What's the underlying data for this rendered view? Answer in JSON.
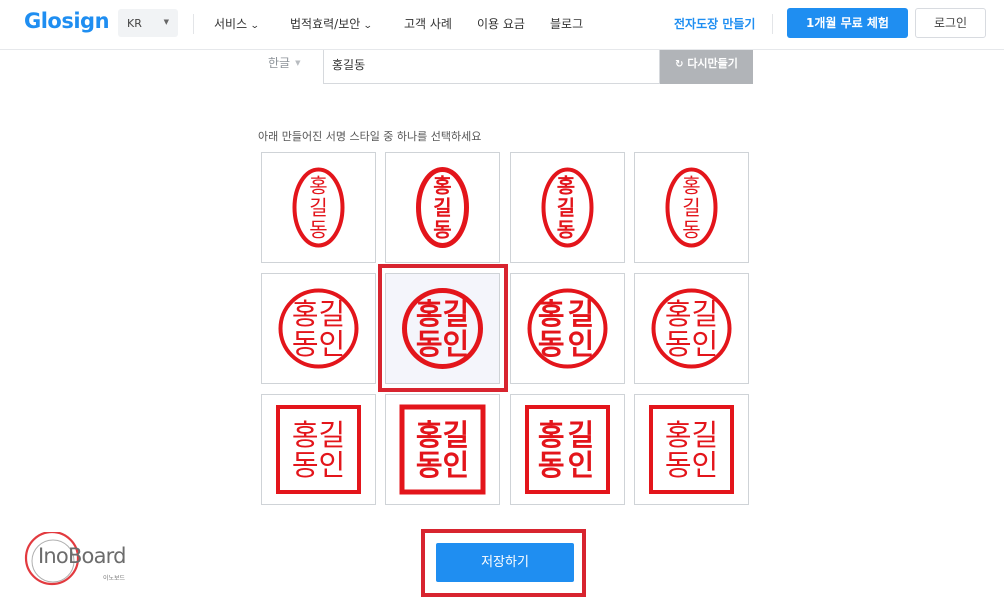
{
  "header": {
    "logo": "Glosign",
    "language": "KR",
    "nav": [
      {
        "label": "서비스",
        "dropdown": true
      },
      {
        "label": "법적효력/보안",
        "dropdown": true
      },
      {
        "label": "고객 사례",
        "dropdown": false
      },
      {
        "label": "이용 요금",
        "dropdown": false
      },
      {
        "label": "블로그",
        "dropdown": false
      }
    ],
    "make_stamp_link": "전자도장 만들기",
    "trial_button": "1개월 무료 체험",
    "login_button": "로그인"
  },
  "form": {
    "script_select": "한글",
    "name_value": "홍길동",
    "regenerate_button": "다시만들기"
  },
  "instruction": "아래 만들어진 서명 스타일 중 하나를 선택하세요",
  "stamp_color": "#e3151b",
  "accent_color": "#1f8ef1",
  "highlight_color": "#d8242f",
  "stamps": [
    {
      "shape": "oval",
      "font_style": "gothic",
      "rows": [
        "홍",
        "길",
        "동"
      ],
      "selected": false
    },
    {
      "shape": "oval",
      "font_style": "bold",
      "rows": [
        "홍",
        "길",
        "동"
      ],
      "selected": false
    },
    {
      "shape": "oval",
      "font_style": "round",
      "rows": [
        "홍",
        "길",
        "동"
      ],
      "selected": false
    },
    {
      "shape": "oval",
      "font_style": "seal",
      "rows": [
        "홍",
        "길",
        "동"
      ],
      "selected": false
    },
    {
      "shape": "circle",
      "font_style": "gothic",
      "rows": [
        "홍길",
        "동인"
      ],
      "selected": false
    },
    {
      "shape": "circle",
      "font_style": "bold",
      "rows": [
        "홍길",
        "동인"
      ],
      "selected": true
    },
    {
      "shape": "circle",
      "font_style": "round",
      "rows": [
        "홍길",
        "동인"
      ],
      "selected": false
    },
    {
      "shape": "circle",
      "font_style": "seal",
      "rows": [
        "홍길",
        "동인"
      ],
      "selected": false
    },
    {
      "shape": "square",
      "font_style": "gothic",
      "rows": [
        "홍길",
        "동인"
      ],
      "selected": false
    },
    {
      "shape": "square",
      "font_style": "bold",
      "rows": [
        "홍길",
        "동인"
      ],
      "selected": false
    },
    {
      "shape": "square",
      "font_style": "round",
      "rows": [
        "홍길",
        "동인"
      ],
      "selected": false
    },
    {
      "shape": "square",
      "font_style": "seal",
      "rows": [
        "홍길",
        "동인"
      ],
      "selected": false
    }
  ],
  "save_button": "저장하기",
  "watermark": {
    "text": "InoBoard",
    "sub": "이노보드"
  }
}
